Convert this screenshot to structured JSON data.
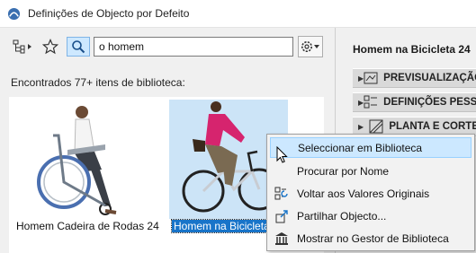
{
  "window": {
    "title": "Definições de Objecto por Defeito",
    "icon": "archicad-logo-icon"
  },
  "toolbar": {
    "tree_icon": "tree-view-icon",
    "favorites_icon": "star-icon",
    "search_icon": "search-icon",
    "settings_icon": "gear-icon",
    "search_value": "o homem"
  },
  "results": {
    "found_text": "Encontrados 77+ itens de biblioteca:",
    "items": [
      {
        "label": "Homem Cadeira de Rodas 24",
        "selected": false
      },
      {
        "label": "Homem na Bicicleta",
        "selected": true
      }
    ]
  },
  "right_panel": {
    "object_title": "Homem na Bicicleta 24",
    "sections": [
      {
        "label": "PREVISUALIZAÇÃO",
        "icon": "preview-icon"
      },
      {
        "label": "DEFINIÇÕES PESSOAIS",
        "icon": "settings-list-icon"
      },
      {
        "label": "PLANTA E CORTE",
        "icon": "floorplan-icon"
      }
    ]
  },
  "context_menu": {
    "items": [
      {
        "label": "Seleccionar em Biblioteca",
        "icon": "",
        "highlighted": true
      },
      {
        "label": "Procurar por Nome",
        "icon": "",
        "highlighted": false
      },
      {
        "label": "Voltar aos Valores Originais",
        "icon": "reset-values-icon",
        "highlighted": false
      },
      {
        "label": "Partilhar Objecto...",
        "icon": "share-object-icon",
        "highlighted": false
      },
      {
        "label": "Mostrar no Gestor de Biblioteca",
        "icon": "library-manager-icon",
        "highlighted": false
      }
    ]
  },
  "colors": {
    "accent": "#1874c9",
    "selection_bg": "#cce4f7",
    "menu_highlight": "#cce8ff"
  }
}
